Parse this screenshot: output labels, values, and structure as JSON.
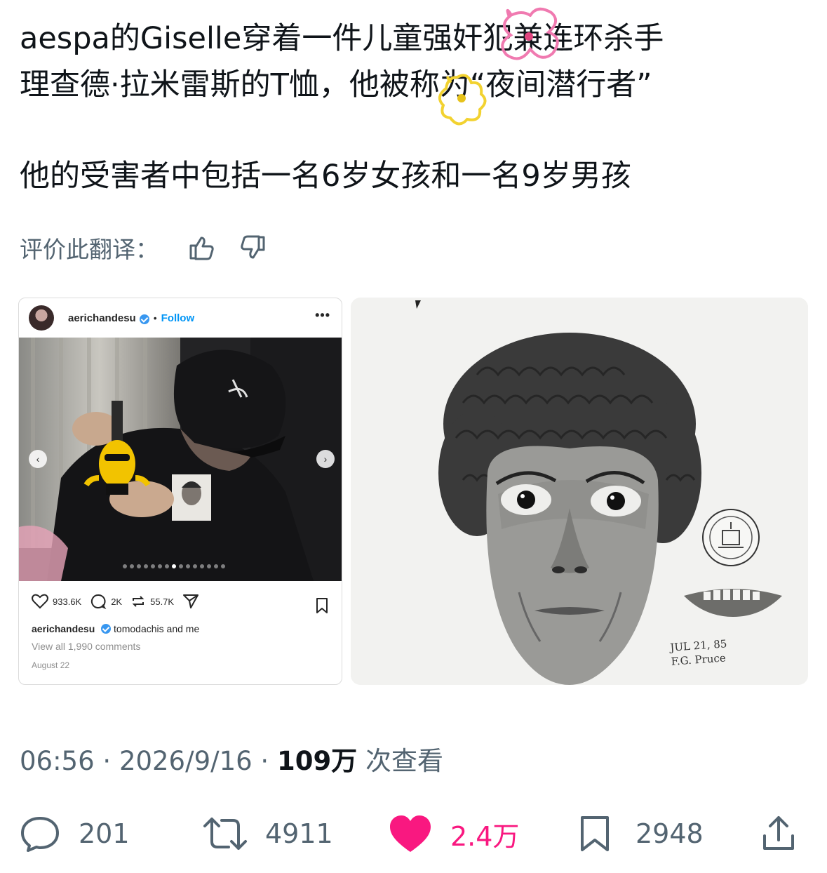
{
  "tweet": {
    "line1": "aespa的Giselle穿着一件儿童强奸犯兼连环杀手",
    "line2": "理查德·拉米雷斯的T恤，他被称为“夜间潜行者”",
    "para2": "他的受害者中包括一名6岁女孩和一名9岁男孩"
  },
  "rate": {
    "label": "评价此翻译：",
    "up_icon": "thumbs-up-icon",
    "down_icon": "thumbs-down-icon"
  },
  "instagram": {
    "username": "aerichandesu",
    "follow": "Follow",
    "more": "•••",
    "likes": "933.6K",
    "comments": "2K",
    "reposts": "55.7K",
    "caption_user": "aerichandesu",
    "caption_text": "tomodachis and me",
    "view_comments": "View all 1,990 comments",
    "date": "August 22",
    "carousel_total": 15,
    "carousel_index": 8
  },
  "sketch": {
    "signature_line1": "JUL 21, 85",
    "signature_line2": "F.G. Pruce"
  },
  "meta": {
    "time": "06:56",
    "date": "2026/9/16",
    "views": "109万",
    "views_suffix": "次查看",
    "sep": "·"
  },
  "actions": {
    "replies": "201",
    "reposts": "4911",
    "likes": "2.4万",
    "bookmarks": "2948"
  },
  "colors": {
    "like_pink": "#f91880",
    "muted": "#536471",
    "ig_blue": "#0095f6"
  }
}
